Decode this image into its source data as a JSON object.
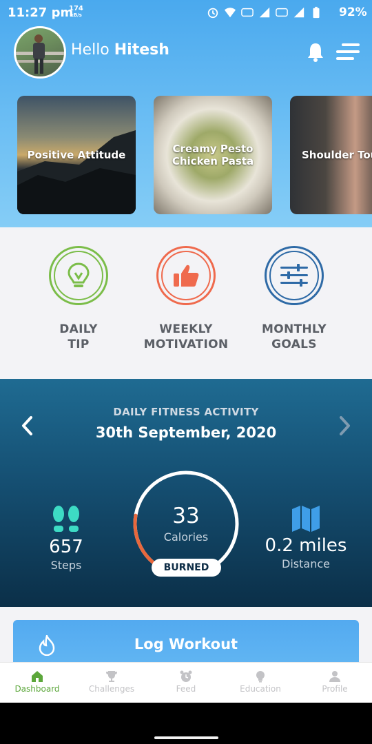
{
  "status": {
    "time": "11:27 pm",
    "speed_value": "174",
    "speed_unit": "kB/s",
    "battery": "92%"
  },
  "header": {
    "greeting_prefix": "Hello",
    "user_name": "Hitesh"
  },
  "cards": [
    {
      "label": "Positive Attitude"
    },
    {
      "label": "Creamy Pesto Chicken Pasta"
    },
    {
      "label": "Shoulder Touch"
    }
  ],
  "quick_actions": [
    {
      "line1": "DAILY",
      "line2": "TIP",
      "color": "#7bbd49",
      "icon": "lightbulb-icon"
    },
    {
      "line1": "WEEKLY",
      "line2": "MOTIVATION",
      "color": "#ef6a4d",
      "icon": "thumbs-up-icon"
    },
    {
      "line1": "MONTHLY",
      "line2": "GOALS",
      "color": "#2e6aa6",
      "icon": "sliders-icon"
    }
  ],
  "activity": {
    "subtitle": "DAILY FITNESS ACTIVITY",
    "date": "30th September, 2020",
    "steps_value": "657",
    "steps_label": "Steps",
    "calories_value": "33",
    "calories_label": "Calories",
    "burned_label": "BURNED",
    "distance_value": "0.2 miles",
    "distance_label": "Distance",
    "ring_progress": 0.22,
    "ring_color": "#e8683d",
    "accent_teal": "#3ddbc4",
    "accent_blue": "#3f9ee8"
  },
  "log_workout": {
    "label": "Log Workout"
  },
  "nav": [
    {
      "label": "Dashboard",
      "icon": "home-icon",
      "active": true
    },
    {
      "label": "Challenges",
      "icon": "trophy-icon",
      "active": false
    },
    {
      "label": "Feed",
      "icon": "alarm-clock-icon",
      "active": false
    },
    {
      "label": "Education",
      "icon": "lightbulb-icon",
      "active": false
    },
    {
      "label": "Profile",
      "icon": "person-icon",
      "active": false
    }
  ]
}
